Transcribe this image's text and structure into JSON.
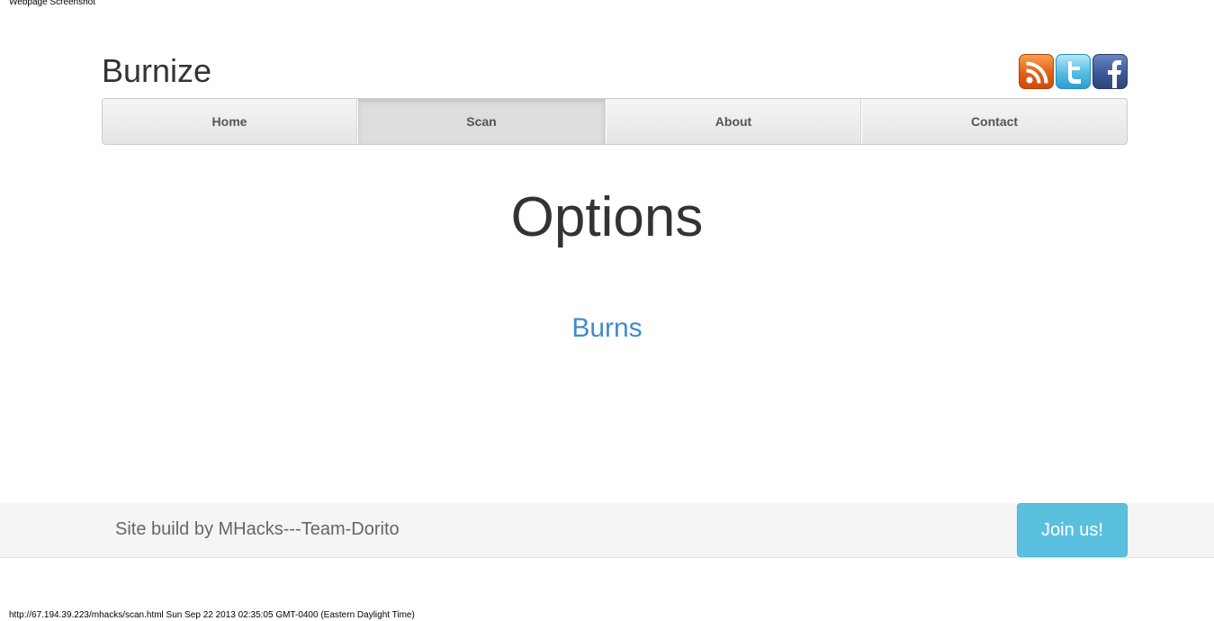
{
  "capture_label": "Webpage Screenshot",
  "brand": "Burnize",
  "social": [
    {
      "name": "rss-icon",
      "icon": "rss-icon"
    },
    {
      "name": "twitter-icon",
      "icon": "twitter-icon"
    },
    {
      "name": "facebook-icon",
      "icon": "facebook-icon"
    }
  ],
  "nav": {
    "items": [
      {
        "label": "Home",
        "active": false
      },
      {
        "label": "Scan",
        "active": true
      },
      {
        "label": "About",
        "active": false
      },
      {
        "label": "Contact",
        "active": false
      }
    ]
  },
  "main": {
    "heading": "Options",
    "link": "Burns"
  },
  "footer": {
    "text": "Site build by MHacks---Team-Dorito",
    "button": "Join us!"
  },
  "status_line": "http://67.194.39.223/mhacks/scan.html Sun Sep 22 2013 02:35:05 GMT-0400 (Eastern Daylight Time)",
  "colors": {
    "link": "#428bca",
    "button": "#5bc0de",
    "rss": "#e0601a",
    "twitter": "#55bce3",
    "facebook": "#3b5998"
  }
}
